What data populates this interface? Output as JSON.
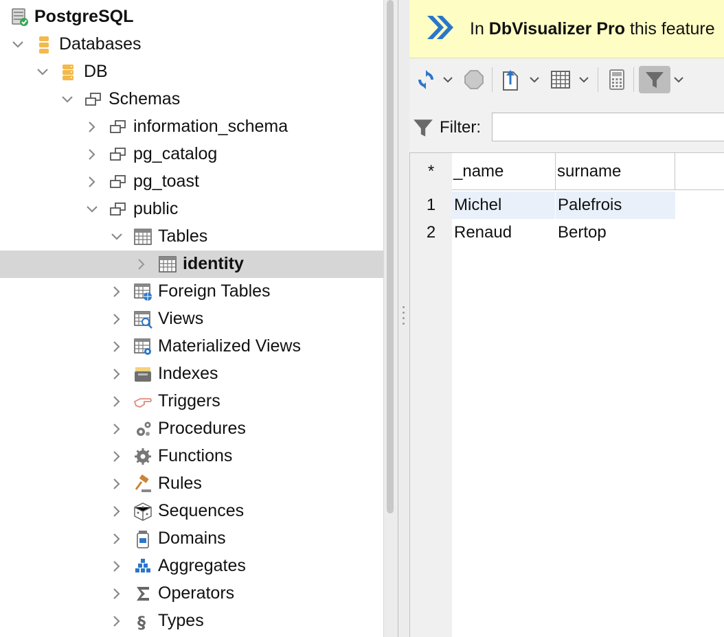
{
  "tree": {
    "items": [
      {
        "label": "PostgreSQL",
        "icon": "server-connected-icon",
        "expanded": true
      },
      {
        "label": "Databases",
        "icon": "databases-icon",
        "expanded": true
      },
      {
        "label": "DB",
        "icon": "database-icon",
        "expanded": true
      },
      {
        "label": "Schemas",
        "icon": "schemas-icon",
        "expanded": true
      },
      {
        "label": "information_schema",
        "icon": "schema-icon",
        "expanded": false
      },
      {
        "label": "pg_catalog",
        "icon": "schema-icon",
        "expanded": false
      },
      {
        "label": "pg_toast",
        "icon": "schema-icon",
        "expanded": false
      },
      {
        "label": "public",
        "icon": "schema-icon",
        "expanded": true
      },
      {
        "label": "Tables",
        "icon": "tables-icon",
        "expanded": true
      },
      {
        "label": "identity",
        "icon": "table-icon",
        "expanded": false,
        "selected": true
      },
      {
        "label": "Foreign Tables",
        "icon": "foreign-tables-icon",
        "expanded": false
      },
      {
        "label": "Views",
        "icon": "views-icon",
        "expanded": false
      },
      {
        "label": "Materialized Views",
        "icon": "materialized-views-icon",
        "expanded": false
      },
      {
        "label": "Indexes",
        "icon": "indexes-icon",
        "expanded": false
      },
      {
        "label": "Triggers",
        "icon": "triggers-icon",
        "expanded": false
      },
      {
        "label": "Procedures",
        "icon": "procedures-icon",
        "expanded": false
      },
      {
        "label": "Functions",
        "icon": "functions-icon",
        "expanded": false
      },
      {
        "label": "Rules",
        "icon": "rules-icon",
        "expanded": false
      },
      {
        "label": "Sequences",
        "icon": "sequences-icon",
        "expanded": false
      },
      {
        "label": "Domains",
        "icon": "domains-icon",
        "expanded": false
      },
      {
        "label": "Aggregates",
        "icon": "aggregates-icon",
        "expanded": false
      },
      {
        "label": "Operators",
        "icon": "operators-icon",
        "expanded": false
      },
      {
        "label": "Types",
        "icon": "types-icon",
        "expanded": false
      }
    ]
  },
  "banner": {
    "prefix": "In ",
    "product": "DbVisualizer Pro",
    "suffix": " this feature"
  },
  "toolbar": {
    "buttons": [
      "refresh-icon",
      "stop-icon",
      "export-icon",
      "grid-options-icon",
      "calculator-icon",
      "filter-toggle-icon"
    ]
  },
  "filter": {
    "label": "Filter:",
    "value": ""
  },
  "grid": {
    "corner": "*",
    "columns": [
      "_name",
      "surname"
    ],
    "rows": [
      {
        "num": "1",
        "cells": [
          "Michel",
          "Palefrois"
        ]
      },
      {
        "num": "2",
        "cells": [
          "Renaud",
          "Bertop"
        ]
      }
    ]
  },
  "colors": {
    "banner_bg": "#fdfdc4",
    "accent_blue": "#2a77c9",
    "selected_row": "#d6d6d6",
    "highlight_row": "#e9f0fa"
  }
}
